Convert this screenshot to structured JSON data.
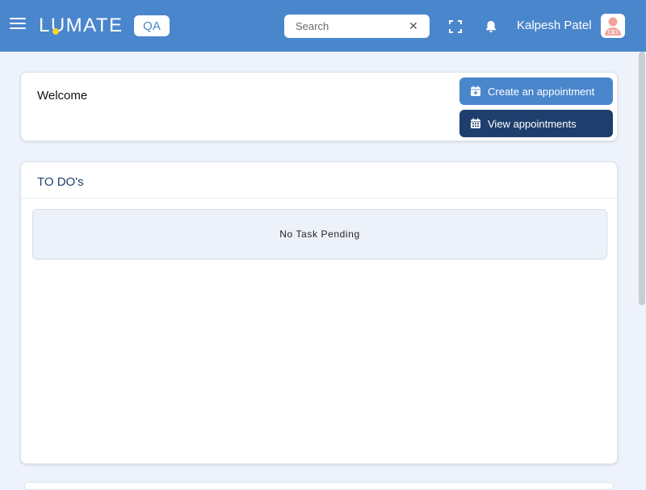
{
  "header": {
    "brand": "LUMATE",
    "env_badge": "QA",
    "search": {
      "placeholder": "Search",
      "value": ""
    },
    "user_name": "Kalpesh Patel",
    "colors": {
      "bar": "#4a86cc",
      "logo_dot": "#f5d42c"
    },
    "icons": [
      "menu-icon",
      "close-icon",
      "fullscreen-icon",
      "bell-icon",
      "avatar-icon"
    ]
  },
  "welcome": {
    "title": "Welcome",
    "create_label": "Create an appointment",
    "view_label": "View appointments",
    "icons": [
      "calendar-plus-icon",
      "calendar-icon"
    ]
  },
  "todos": {
    "title": "TO DO's",
    "empty_message": "No Task Pending"
  }
}
